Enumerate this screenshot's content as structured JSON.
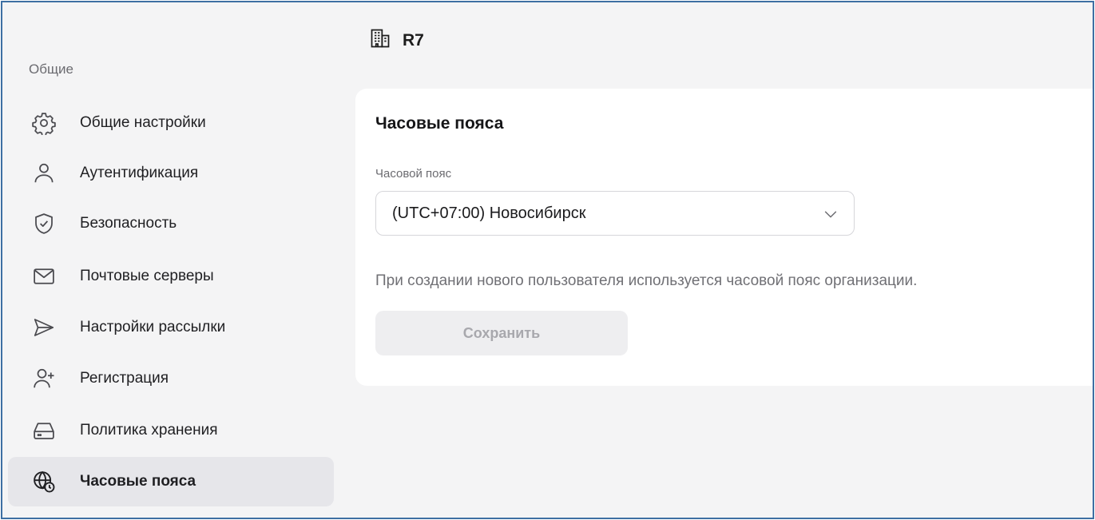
{
  "sidebar": {
    "section_label": "Общие",
    "items": [
      {
        "label": "Общие настройки",
        "icon": "gear-icon",
        "active": false
      },
      {
        "label": "Аутентификация",
        "icon": "user-icon",
        "active": false
      },
      {
        "label": "Безопасность",
        "icon": "shield-check-icon",
        "active": false
      },
      {
        "label": "Почтовые серверы",
        "icon": "mail-icon",
        "active": false
      },
      {
        "label": "Настройки рассылки",
        "icon": "send-icon",
        "active": false
      },
      {
        "label": "Регистрация",
        "icon": "user-plus-icon",
        "active": false
      },
      {
        "label": "Политика хранения",
        "icon": "storage-drive-icon",
        "active": false
      },
      {
        "label": "Часовые пояса",
        "icon": "globe-clock-icon",
        "active": true
      }
    ]
  },
  "header": {
    "org_name": "R7",
    "icon": "building-icon"
  },
  "card": {
    "title": "Часовые пояса",
    "field_label": "Часовой пояс",
    "timezone_value": "(UTC+07:00) Новосибирск",
    "hint": "При создании нового пользователя используется часовой пояс организации.",
    "save_label": "Сохранить"
  },
  "colors": {
    "border": "#3e6fa3",
    "background": "#f4f4f5",
    "active_item": "#e6e6ea",
    "disabled_button": "#eeeef0",
    "disabled_text": "#a8a8ad"
  }
}
